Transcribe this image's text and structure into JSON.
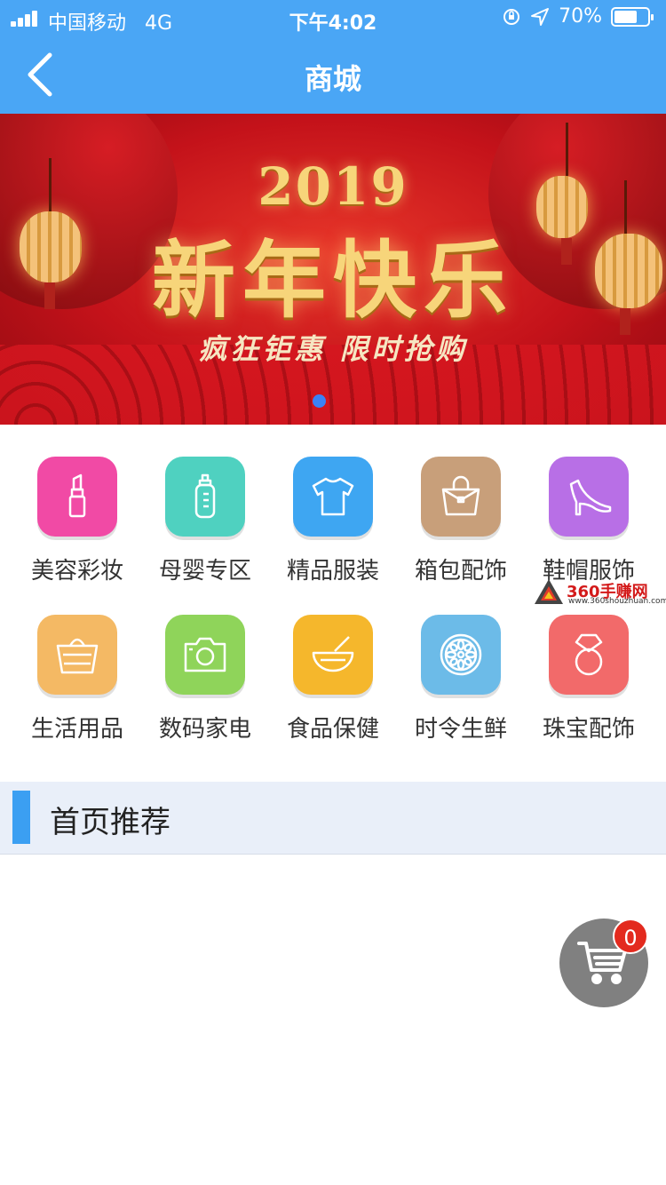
{
  "status_bar": {
    "carrier": "中国移动",
    "network": "4G",
    "time": "下午4:02",
    "battery_percent": "70%",
    "battery_level": 0.7
  },
  "nav": {
    "title": "商城"
  },
  "banner": {
    "year": "2019",
    "headline": "新年快乐",
    "subtitle": "疯狂钜惠  限时抢购",
    "slides": 1,
    "active_slide": 1
  },
  "categories": [
    {
      "label": "美容彩妆",
      "icon": "lipstick-icon",
      "color": "#f14aa5"
    },
    {
      "label": "母婴专区",
      "icon": "baby-bottle-icon",
      "color": "#4fd1c0"
    },
    {
      "label": "精品服装",
      "icon": "tshirt-icon",
      "color": "#3ea6f2"
    },
    {
      "label": "箱包配饰",
      "icon": "handbag-icon",
      "color": "#c89f7a"
    },
    {
      "label": "鞋帽服饰",
      "icon": "high-heel-icon",
      "color": "#b86fe6"
    },
    {
      "label": "生活用品",
      "icon": "basket-icon",
      "color": "#f4b964"
    },
    {
      "label": "数码家电",
      "icon": "camera-icon",
      "color": "#8fd45a"
    },
    {
      "label": "食品保健",
      "icon": "bowl-icon",
      "color": "#f5b72c"
    },
    {
      "label": "时令生鲜",
      "icon": "citrus-slice-icon",
      "color": "#6cbbe8"
    },
    {
      "label": "珠宝配饰",
      "icon": "ring-icon",
      "color": "#f26a6a"
    }
  ],
  "watermark": {
    "brand": "360手赚网",
    "url": "www.360shouzhuan.com"
  },
  "section": {
    "title": "首页推荐"
  },
  "cart": {
    "count": "0"
  },
  "colors": {
    "primary": "#4aa6f5",
    "section_bg": "#e9eff9",
    "badge": "#e32a1e"
  }
}
